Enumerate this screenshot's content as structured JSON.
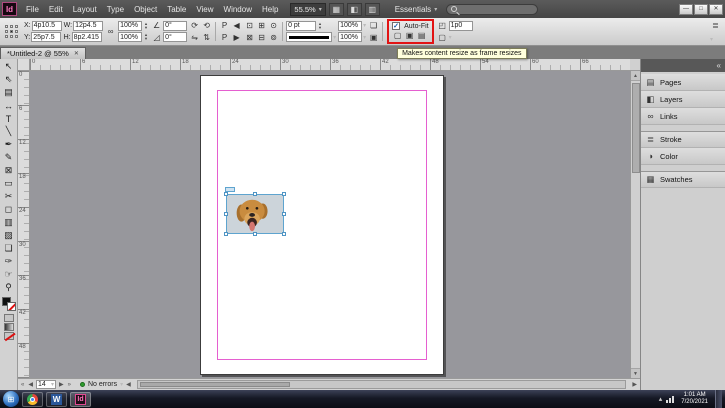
{
  "menubar": {
    "app_logo": "Id",
    "menus": [
      "File",
      "Edit",
      "Layout",
      "Type",
      "Object",
      "Table",
      "View",
      "Window",
      "Help"
    ],
    "zoom_value": "55.5%",
    "workspace_label": "Essentials",
    "search_placeholder": "",
    "window_buttons": {
      "minimize": "—",
      "restore": "□",
      "close": "✕"
    }
  },
  "control_panel": {
    "x_label": "X:",
    "x_value": "4p10.5",
    "y_label": "Y:",
    "y_value": "25p7.5",
    "w_label": "W:",
    "w_value": "12p4.5",
    "h_label": "H:",
    "h_value": "8p2.415",
    "scale_x": "100%",
    "scale_y": "100%",
    "rotation_angle": "0°",
    "shear_angle": "0°",
    "stroke_weight": "0 pt",
    "opacity": "100%",
    "opacity_row2": "100%",
    "autofit_label": "Auto-Fit",
    "autofit_check_glyph": "✓",
    "corner_radius": "1p0",
    "tooltip": "Makes content resize as frame resizes"
  },
  "icons": {
    "view_options": "▦",
    "screen_mode": "◧",
    "arrange_docs": "▥",
    "chain": "∞",
    "flip_h": "⇋",
    "flip_v": "⇅",
    "rotate_cw": "⟳",
    "rotate_ccw": "⟲",
    "angle_glyph": "∠",
    "shear_glyph": "◿",
    "style_p": "P",
    "prev": "◀",
    "next": "▶",
    "fit1": "⊡",
    "fit2": "⊞",
    "fit3": "⊙",
    "fit4": "⊠",
    "fit5": "⊟",
    "fit6": "⊚",
    "stepper_up": "▴",
    "stepper_down": "▾",
    "dd": "▾",
    "effects1": "❏",
    "effects2": "▣",
    "wrap1": "▢",
    "wrap2": "▣",
    "wrap3": "▤",
    "corner_glyph": "◰",
    "panel_menu": "≣",
    "expand_panels": "«",
    "first": "«",
    "last": "»",
    "scroll_up": "▲",
    "scroll_down": "▼",
    "scroll_left": "◀",
    "scroll_right": "▶",
    "tray_hidden": "▴",
    "start_glyph": "⊞"
  },
  "tabbar": {
    "document_title": "*Untitled-2 @ 55%",
    "close_glyph": "✕"
  },
  "toolbar": {
    "tools": [
      {
        "name": "selection-tool",
        "glyph": "↖"
      },
      {
        "name": "direct-selection-tool",
        "glyph": "⇖"
      },
      {
        "name": "page-tool",
        "glyph": "▤"
      },
      {
        "name": "gap-tool",
        "glyph": "↔"
      },
      {
        "name": "type-tool",
        "glyph": "T"
      },
      {
        "name": "line-tool",
        "glyph": "╲"
      },
      {
        "name": "pen-tool",
        "glyph": "✒"
      },
      {
        "name": "pencil-tool",
        "glyph": "✎"
      },
      {
        "name": "rectangle-frame-tool",
        "glyph": "⊠"
      },
      {
        "name": "rectangle-tool",
        "glyph": "▭"
      },
      {
        "name": "scissors-tool",
        "glyph": "✂"
      },
      {
        "name": "free-transform-tool",
        "glyph": "◻"
      },
      {
        "name": "gradient-swatch-tool",
        "glyph": "▥"
      },
      {
        "name": "gradient-feather-tool",
        "glyph": "▨"
      },
      {
        "name": "note-tool",
        "glyph": "❏"
      },
      {
        "name": "eyedropper-tool",
        "glyph": "✑"
      },
      {
        "name": "hand-tool",
        "glyph": "☞"
      },
      {
        "name": "zoom-tool",
        "glyph": "⚲"
      }
    ]
  },
  "rulers": {
    "horizontal": [
      "0",
      "6",
      "12",
      "18",
      "24",
      "30",
      "36",
      "42",
      "48",
      "54",
      "60",
      "66"
    ],
    "vertical": [
      "0",
      "6",
      "12",
      "18",
      "24",
      "30",
      "36",
      "42",
      "48"
    ]
  },
  "right_panel": {
    "items": [
      {
        "name": "pages",
        "label": "Pages",
        "glyph": "▤"
      },
      {
        "name": "layers",
        "label": "Layers",
        "glyph": "◧"
      },
      {
        "name": "links",
        "label": "Links",
        "glyph": "∞"
      },
      {
        "name": "stroke",
        "label": "Stroke",
        "glyph": "≣",
        "divider": true
      },
      {
        "name": "color",
        "label": "Color",
        "glyph": "◑"
      },
      {
        "name": "swatches",
        "label": "Swatches",
        "glyph": "▦",
        "divider": true
      }
    ]
  },
  "statusbar": {
    "page_number": "14",
    "error_label": "No errors"
  },
  "taskbar": {
    "word_label": "W",
    "indesign_label": "Id",
    "time": "1:01 AM",
    "date": "7/20/2021"
  }
}
